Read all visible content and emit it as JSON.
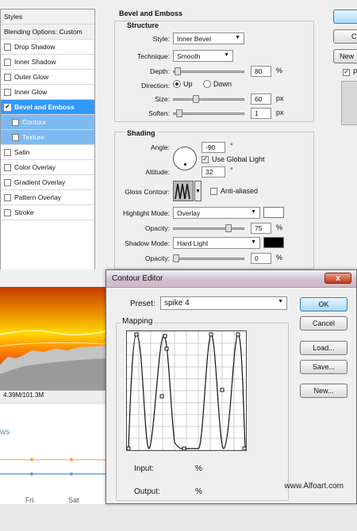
{
  "styles_panel": {
    "title": "Styles",
    "items": [
      {
        "label": "Blending Options: Custom"
      },
      {
        "label": "Drop Shadow",
        "checked": false
      },
      {
        "label": "Inner Shadow",
        "checked": false
      },
      {
        "label": "Outer Glow",
        "checked": false
      },
      {
        "label": "Inner Glow",
        "checked": false
      },
      {
        "label": "Bevel and Emboss",
        "checked": true
      },
      {
        "label": "Contour",
        "checked": false
      },
      {
        "label": "Texture",
        "checked": false
      },
      {
        "label": "Satin",
        "checked": false
      },
      {
        "label": "Color Overlay",
        "checked": false
      },
      {
        "label": "Gradient Overlay",
        "checked": false
      },
      {
        "label": "Pattern Overlay",
        "checked": false
      },
      {
        "label": "Stroke",
        "checked": false
      }
    ]
  },
  "bevel": {
    "section_title": "Bevel and Emboss",
    "structure": {
      "title": "Structure",
      "style_label": "Style:",
      "style_value": "Inner Bevel",
      "technique_label": "Technique:",
      "technique_value": "Smooth",
      "depth_label": "Depth:",
      "depth_value": "80",
      "depth_unit": "%",
      "direction_label": "Direction:",
      "up_label": "Up",
      "down_label": "Down",
      "size_label": "Size:",
      "size_value": "60",
      "size_unit": "px",
      "soften_label": "Soften:",
      "soften_value": "1",
      "soften_unit": "px"
    },
    "shading": {
      "title": "Shading",
      "angle_label": "Angle:",
      "angle_value": "-90",
      "angle_unit": "°",
      "global_light_label": "Use Global Light",
      "altitude_label": "Altitude:",
      "altitude_value": "32",
      "altitude_unit": "°",
      "gloss_label": "Gloss Contour:",
      "anti_aliased_label": "Anti-aliased",
      "highlight_mode_label": "Highlight Mode:",
      "highlight_mode_value": "Overlay",
      "highlight_opacity_label": "Opacity:",
      "highlight_opacity_value": "75",
      "highlight_opacity_unit": "%",
      "shadow_mode_label": "Shadow Mode:",
      "shadow_mode_value": "Hard Light",
      "shadow_opacity_label": "Opacity:",
      "shadow_opacity_value": "0",
      "shadow_opacity_unit": "%"
    }
  },
  "right_buttons": {
    "c_label": "C",
    "new_label": "New"
  },
  "status_bar": {
    "text": "4.39M/101.3M"
  },
  "background_chart": {
    "partial_label": "ws",
    "days": [
      "Fri",
      "Sat"
    ]
  },
  "contour_editor": {
    "title": "Contour Editor",
    "close_label": "x",
    "preset_label": "Preset:",
    "preset_value": "spike 4",
    "mapping_title": "Mapping",
    "input_label": "Input:",
    "input_unit": "%",
    "output_label": "Output:",
    "output_unit": "%",
    "ok_label": "OK",
    "cancel_label": "Cancel",
    "load_label": "Load...",
    "save_label": "Save...",
    "new_label": "New..."
  },
  "watermark": "www.Alfoart.com",
  "colors": {
    "selection": "#3399ff",
    "subselection": "#7db9f3",
    "shadow_swatch": "#000000",
    "highlight_swatch": "#ffffff"
  }
}
